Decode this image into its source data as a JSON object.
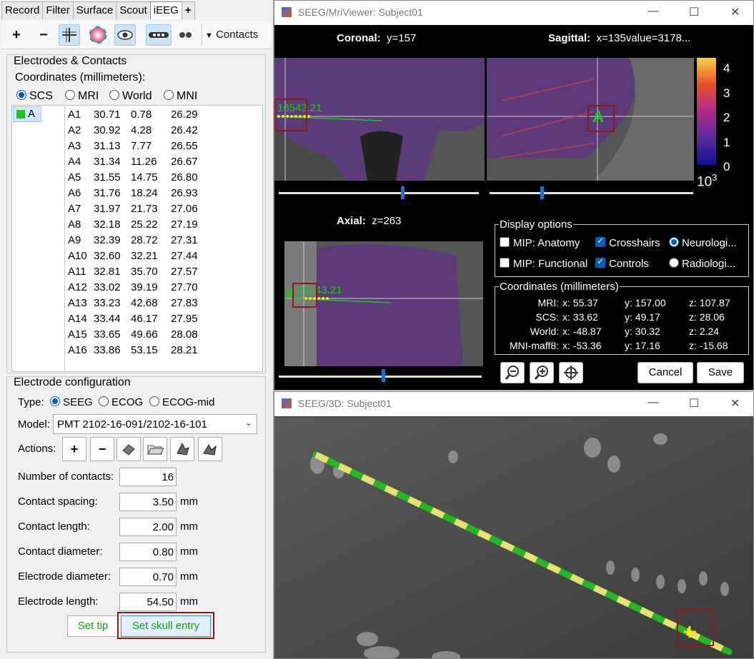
{
  "tabs": [
    "Record",
    "Filter",
    "Surface",
    "Scout",
    "iEEG",
    "+"
  ],
  "active_tab": "iEEG",
  "toolbar": {
    "add": "+",
    "remove": "−",
    "contacts_label": "Contacts"
  },
  "electrodes": {
    "title": "Electrodes & Contacts",
    "coords_label": "Coordinates (millimeters):",
    "coord_systems": [
      "SCS",
      "MRI",
      "World",
      "MNI"
    ],
    "selected_system": "SCS",
    "electrode_list": [
      {
        "name": "A",
        "color": "#22c422"
      }
    ],
    "contacts": [
      [
        "A1",
        "30.71",
        "0.78",
        "26.29"
      ],
      [
        "A2",
        "30.92",
        "4.28",
        "26.42"
      ],
      [
        "A3",
        "31.13",
        "7.77",
        "26.55"
      ],
      [
        "A4",
        "31.34",
        "11.26",
        "26.67"
      ],
      [
        "A5",
        "31.55",
        "14.75",
        "26.80"
      ],
      [
        "A6",
        "31.76",
        "18.24",
        "26.93"
      ],
      [
        "A7",
        "31.97",
        "21.73",
        "27.06"
      ],
      [
        "A8",
        "32.18",
        "25.22",
        "27.19"
      ],
      [
        "A9",
        "32.39",
        "28.72",
        "27.31"
      ],
      [
        "A10",
        "32.60",
        "32.21",
        "27.44"
      ],
      [
        "A11",
        "32.81",
        "35.70",
        "27.57"
      ],
      [
        "A12",
        "33.02",
        "39.19",
        "27.70"
      ],
      [
        "A13",
        "33.23",
        "42.68",
        "27.83"
      ],
      [
        "A14",
        "33.44",
        "46.17",
        "27.95"
      ],
      [
        "A15",
        "33.65",
        "49.66",
        "28.08"
      ],
      [
        "A16",
        "33.86",
        "53.15",
        "28.21"
      ]
    ]
  },
  "config": {
    "title": "Electrode configuration",
    "type_label": "Type:",
    "types": [
      "SEEG",
      "ECOG",
      "ECOG-mid"
    ],
    "selected_type": "SEEG",
    "model_label": "Model:",
    "model_value": "PMT 2102-16-091/2102-16-101",
    "actions_label": "Actions:",
    "fields": [
      {
        "label": "Number of contacts:",
        "value": "16",
        "unit": ""
      },
      {
        "label": "Contact spacing:",
        "value": "3.50",
        "unit": "mm"
      },
      {
        "label": "Contact length:",
        "value": "2.00",
        "unit": "mm"
      },
      {
        "label": "Contact diameter:",
        "value": "0.80",
        "unit": "mm"
      },
      {
        "label": "Electrode diameter:",
        "value": "0.70",
        "unit": "mm"
      },
      {
        "label": "Electrode length:",
        "value": "54.50",
        "unit": "mm"
      }
    ],
    "set_tip": "Set tip",
    "set_skull_entry": "Set skull entry"
  },
  "mri_viewer": {
    "title": "SEEG/MriViewer: Subject01",
    "coronal_label": "Coronal:",
    "coronal_value": "y=157",
    "sagittal_label": "Sagittal:",
    "sagittal_value": "x=135value=3178...",
    "axial_label": "Axial:",
    "axial_value": "z=263",
    "colorbar_ticks": [
      "4",
      "3",
      "2",
      "1",
      "0"
    ],
    "colorbar_exp": "10",
    "colorbar_exp_sup": "3",
    "marker_label": "A",
    "overlap_labels": "16543.21",
    "display_options": {
      "title": "Display options",
      "mip_anatomy": "MIP: Anatomy",
      "crosshairs": "Crosshairs",
      "neurological": "Neurologi...",
      "mip_functional": "MIP: Functional",
      "controls": "Controls",
      "radiological": "Radiologi..."
    },
    "coordinates": {
      "title": "Coordinates (millimeters)",
      "rows": [
        {
          "name": "MRI:",
          "x": "x: 55.37",
          "y": "y: 157.00",
          "z": "z: 107.87"
        },
        {
          "name": "SCS:",
          "x": "x: 33.62",
          "y": "y: 49.17",
          "z": "z: 28.06"
        },
        {
          "name": "World:",
          "x": "x: -48.87",
          "y": "y: 30.32",
          "z": "z: 2.24"
        },
        {
          "name": "MNI-maff8:",
          "x": "x: -53.36",
          "y": "y: 17.16",
          "z": "z: -15.68"
        }
      ]
    },
    "cancel": "Cancel",
    "save": "Save"
  },
  "viewer_3d": {
    "title": "SEEG/3D: Subject01"
  },
  "colors": {
    "accent": "#005fb8",
    "highlight": "#8b1a1a",
    "green": "#22c422",
    "yellow": "#e8e800"
  }
}
